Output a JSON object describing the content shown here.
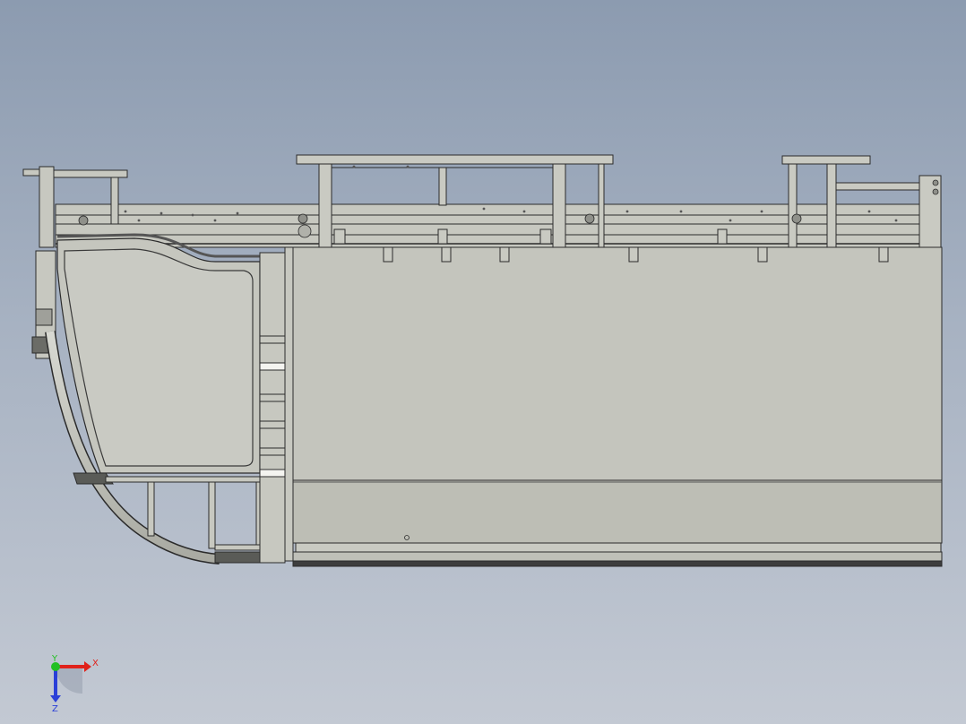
{
  "viewport": {
    "background_top": "#8c9bb0",
    "background_bottom": "#c3c9d3"
  },
  "model": {
    "panel_color": "#c4c5bd",
    "panel_lower_color": "#bdbeb5",
    "outline_color": "#2b2b2b",
    "dark_trim_color": "#4a4a4a"
  },
  "triad": {
    "x_label": "X",
    "y_label": "Y",
    "z_label": "Z",
    "x_color": "#e0221b",
    "y_color": "#22c022",
    "z_color": "#2a3fd8"
  }
}
